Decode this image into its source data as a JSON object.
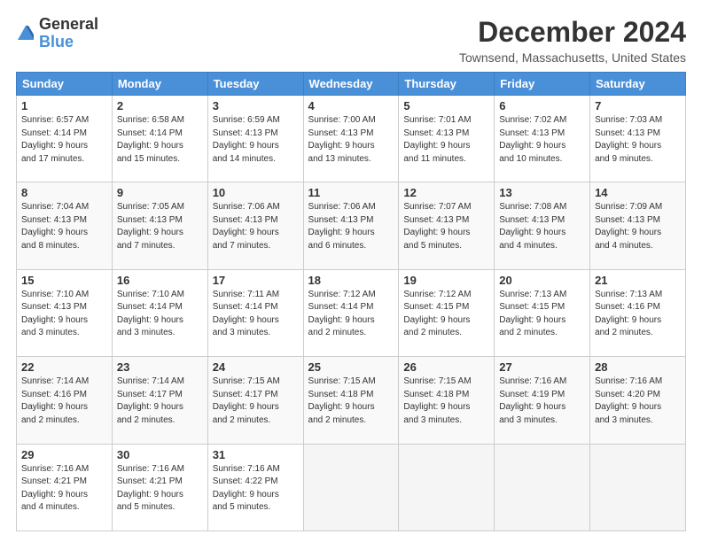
{
  "logo": {
    "line1": "General",
    "line2": "Blue"
  },
  "title": "December 2024",
  "location": "Townsend, Massachusetts, United States",
  "days_of_week": [
    "Sunday",
    "Monday",
    "Tuesday",
    "Wednesday",
    "Thursday",
    "Friday",
    "Saturday"
  ],
  "weeks": [
    [
      {
        "day": "1",
        "info": "Sunrise: 6:57 AM\nSunset: 4:14 PM\nDaylight: 9 hours\nand 17 minutes."
      },
      {
        "day": "2",
        "info": "Sunrise: 6:58 AM\nSunset: 4:14 PM\nDaylight: 9 hours\nand 15 minutes."
      },
      {
        "day": "3",
        "info": "Sunrise: 6:59 AM\nSunset: 4:13 PM\nDaylight: 9 hours\nand 14 minutes."
      },
      {
        "day": "4",
        "info": "Sunrise: 7:00 AM\nSunset: 4:13 PM\nDaylight: 9 hours\nand 13 minutes."
      },
      {
        "day": "5",
        "info": "Sunrise: 7:01 AM\nSunset: 4:13 PM\nDaylight: 9 hours\nand 11 minutes."
      },
      {
        "day": "6",
        "info": "Sunrise: 7:02 AM\nSunset: 4:13 PM\nDaylight: 9 hours\nand 10 minutes."
      },
      {
        "day": "7",
        "info": "Sunrise: 7:03 AM\nSunset: 4:13 PM\nDaylight: 9 hours\nand 9 minutes."
      }
    ],
    [
      {
        "day": "8",
        "info": "Sunrise: 7:04 AM\nSunset: 4:13 PM\nDaylight: 9 hours\nand 8 minutes."
      },
      {
        "day": "9",
        "info": "Sunrise: 7:05 AM\nSunset: 4:13 PM\nDaylight: 9 hours\nand 7 minutes."
      },
      {
        "day": "10",
        "info": "Sunrise: 7:06 AM\nSunset: 4:13 PM\nDaylight: 9 hours\nand 7 minutes."
      },
      {
        "day": "11",
        "info": "Sunrise: 7:06 AM\nSunset: 4:13 PM\nDaylight: 9 hours\nand 6 minutes."
      },
      {
        "day": "12",
        "info": "Sunrise: 7:07 AM\nSunset: 4:13 PM\nDaylight: 9 hours\nand 5 minutes."
      },
      {
        "day": "13",
        "info": "Sunrise: 7:08 AM\nSunset: 4:13 PM\nDaylight: 9 hours\nand 4 minutes."
      },
      {
        "day": "14",
        "info": "Sunrise: 7:09 AM\nSunset: 4:13 PM\nDaylight: 9 hours\nand 4 minutes."
      }
    ],
    [
      {
        "day": "15",
        "info": "Sunrise: 7:10 AM\nSunset: 4:13 PM\nDaylight: 9 hours\nand 3 minutes."
      },
      {
        "day": "16",
        "info": "Sunrise: 7:10 AM\nSunset: 4:14 PM\nDaylight: 9 hours\nand 3 minutes."
      },
      {
        "day": "17",
        "info": "Sunrise: 7:11 AM\nSunset: 4:14 PM\nDaylight: 9 hours\nand 3 minutes."
      },
      {
        "day": "18",
        "info": "Sunrise: 7:12 AM\nSunset: 4:14 PM\nDaylight: 9 hours\nand 2 minutes."
      },
      {
        "day": "19",
        "info": "Sunrise: 7:12 AM\nSunset: 4:15 PM\nDaylight: 9 hours\nand 2 minutes."
      },
      {
        "day": "20",
        "info": "Sunrise: 7:13 AM\nSunset: 4:15 PM\nDaylight: 9 hours\nand 2 minutes."
      },
      {
        "day": "21",
        "info": "Sunrise: 7:13 AM\nSunset: 4:16 PM\nDaylight: 9 hours\nand 2 minutes."
      }
    ],
    [
      {
        "day": "22",
        "info": "Sunrise: 7:14 AM\nSunset: 4:16 PM\nDaylight: 9 hours\nand 2 minutes."
      },
      {
        "day": "23",
        "info": "Sunrise: 7:14 AM\nSunset: 4:17 PM\nDaylight: 9 hours\nand 2 minutes."
      },
      {
        "day": "24",
        "info": "Sunrise: 7:15 AM\nSunset: 4:17 PM\nDaylight: 9 hours\nand 2 minutes."
      },
      {
        "day": "25",
        "info": "Sunrise: 7:15 AM\nSunset: 4:18 PM\nDaylight: 9 hours\nand 2 minutes."
      },
      {
        "day": "26",
        "info": "Sunrise: 7:15 AM\nSunset: 4:18 PM\nDaylight: 9 hours\nand 3 minutes."
      },
      {
        "day": "27",
        "info": "Sunrise: 7:16 AM\nSunset: 4:19 PM\nDaylight: 9 hours\nand 3 minutes."
      },
      {
        "day": "28",
        "info": "Sunrise: 7:16 AM\nSunset: 4:20 PM\nDaylight: 9 hours\nand 3 minutes."
      }
    ],
    [
      {
        "day": "29",
        "info": "Sunrise: 7:16 AM\nSunset: 4:21 PM\nDaylight: 9 hours\nand 4 minutes."
      },
      {
        "day": "30",
        "info": "Sunrise: 7:16 AM\nSunset: 4:21 PM\nDaylight: 9 hours\nand 5 minutes."
      },
      {
        "day": "31",
        "info": "Sunrise: 7:16 AM\nSunset: 4:22 PM\nDaylight: 9 hours\nand 5 minutes."
      },
      null,
      null,
      null,
      null
    ]
  ]
}
